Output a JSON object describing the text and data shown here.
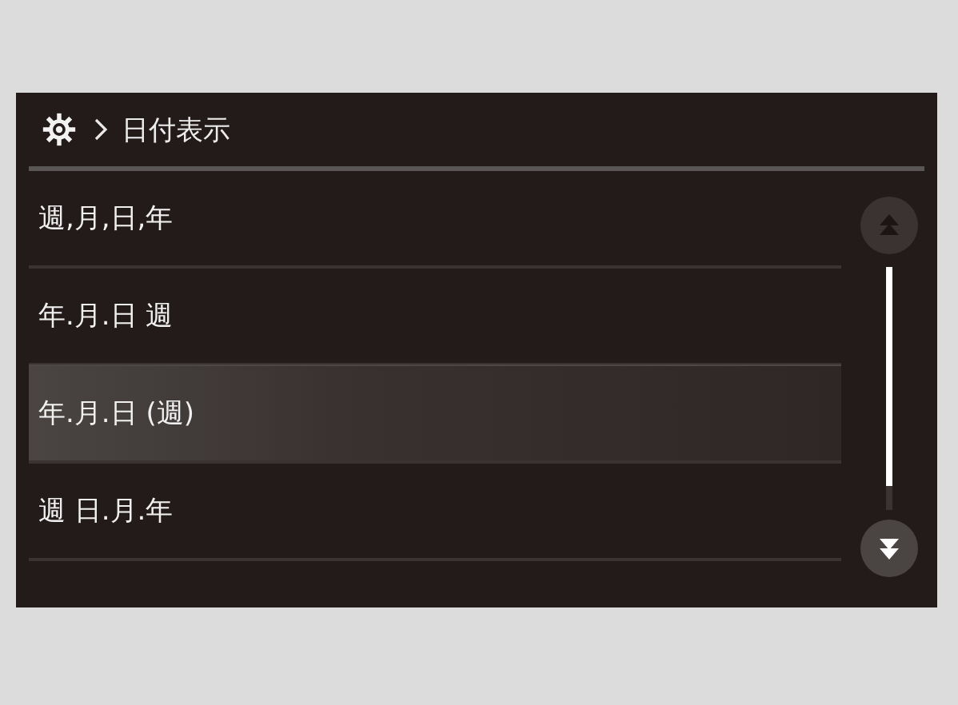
{
  "header": {
    "title": "日付表示"
  },
  "options": [
    {
      "label": "週,月,日,年",
      "selected": false
    },
    {
      "label": "年.月.日 週",
      "selected": false
    },
    {
      "label": "年.月.日 (週)",
      "selected": true
    },
    {
      "label": "週 日.月.年",
      "selected": false
    }
  ],
  "scroll": {
    "up": {
      "disabled": true
    },
    "down": {
      "disabled": false
    }
  }
}
